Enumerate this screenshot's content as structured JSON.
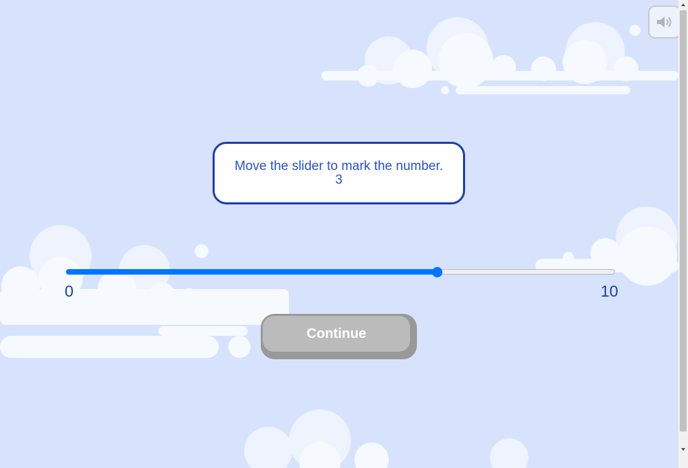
{
  "prompt": {
    "instruction": "Move the slider to mark the number.",
    "target_number": "3"
  },
  "slider": {
    "min_label": "0",
    "max_label": "10",
    "min": 0,
    "max": 10,
    "value": 6.75
  },
  "continue_button": {
    "label": "Continue"
  },
  "sound_button": {
    "icon": "speaker-icon"
  },
  "colors": {
    "background": "#d7e3fc",
    "accent": "#0075ff",
    "prompt_border": "#1e3faa",
    "prompt_text": "#2653c8",
    "button_disabled": "#bbbbbb"
  }
}
